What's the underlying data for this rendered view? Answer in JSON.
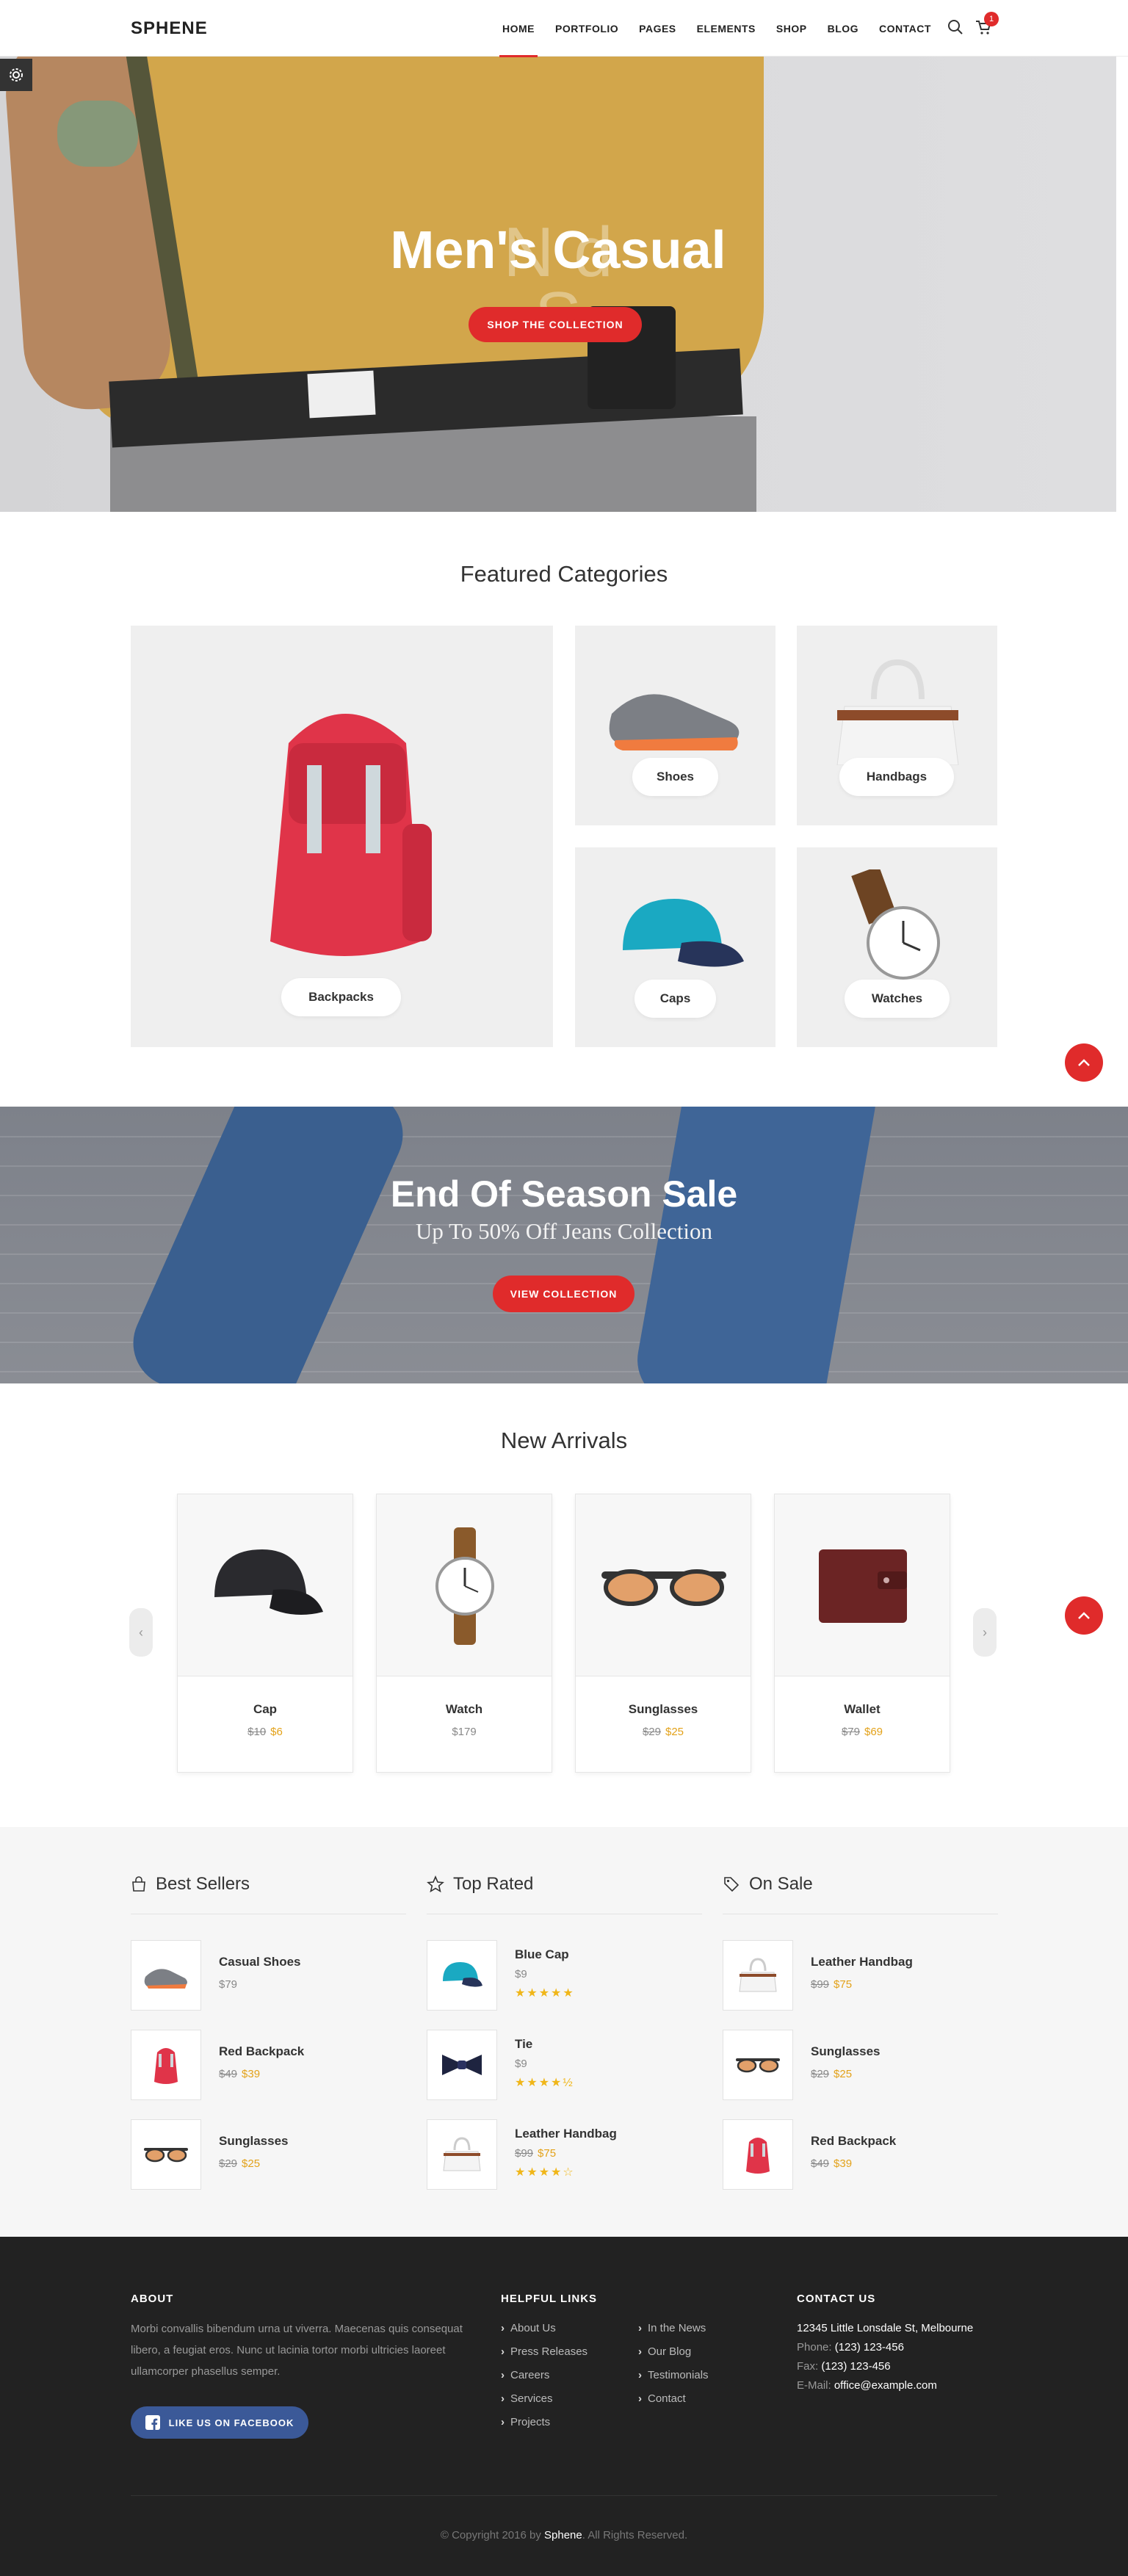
{
  "header": {
    "logo": "SPHENE",
    "nav": [
      "HOME",
      "PORTFOLIO",
      "PAGES",
      "ELEMENTS",
      "SHOP",
      "BLOG",
      "CONTACT"
    ],
    "active_nav": "HOME",
    "cart_count": "1"
  },
  "hero": {
    "ghost_line1": "N          d",
    "ghost_line2": "S",
    "title": "Men's Casual",
    "button": "SHOP THE COLLECTION"
  },
  "featured": {
    "title": "Featured Categories",
    "categories": [
      "Backpacks",
      "Shoes",
      "Handbags",
      "Caps",
      "Watches"
    ]
  },
  "sale": {
    "title": "End Of Season Sale",
    "subtitle": "Up To 50% Off Jeans Collection",
    "button": "VIEW COLLECTION"
  },
  "arrivals": {
    "title": "New Arrivals",
    "products": [
      {
        "name": "Cap",
        "old_price": "$10",
        "price": "$6"
      },
      {
        "name": "Watch",
        "old_price": "",
        "price": "$179"
      },
      {
        "name": "Sunglasses",
        "old_price": "$29",
        "price": "$25"
      },
      {
        "name": "Wallet",
        "old_price": "$79",
        "price": "$69"
      }
    ],
    "prev_arrow": "‹",
    "next_arrow": "›"
  },
  "lists": {
    "best_sellers": {
      "title": "Best Sellers",
      "items": [
        {
          "name": "Casual Shoes",
          "old_price": "",
          "price": "$79"
        },
        {
          "name": "Red Backpack",
          "old_price": "$49",
          "price": "$39"
        },
        {
          "name": "Sunglasses",
          "old_price": "$29",
          "price": "$25"
        }
      ]
    },
    "top_rated": {
      "title": "Top Rated",
      "items": [
        {
          "name": "Blue Cap",
          "old_price": "",
          "price": "$9",
          "stars": "★★★★★"
        },
        {
          "name": "Tie",
          "old_price": "",
          "price": "$9",
          "stars": "★★★★½"
        },
        {
          "name": "Leather Handbag",
          "old_price": "$99",
          "price": "$75",
          "stars": "★★★★☆"
        }
      ]
    },
    "on_sale": {
      "title": "On Sale",
      "items": [
        {
          "name": "Leather Handbag",
          "old_price": "$99",
          "price": "$75"
        },
        {
          "name": "Sunglasses",
          "old_price": "$29",
          "price": "$25"
        },
        {
          "name": "Red Backpack",
          "old_price": "$49",
          "price": "$39"
        }
      ]
    }
  },
  "footer": {
    "about_title": "ABOUT",
    "about_line1": "Morbi convallis bibendum urna ut viverra. Maecenas quis consequat",
    "about_line2": "libero, a feugiat eros. Nunc ut lacinia tortor morbi ultricies laoreet",
    "about_line3": "ullamcorper phasellus semper.",
    "facebook_button": "LIKE US ON FACEBOOK",
    "links_title": "HELPFUL LINKS",
    "links_col1": [
      "About Us",
      "Press Releases",
      "Careers",
      "Services",
      "Projects"
    ],
    "links_col2": [
      "In the News",
      "Our Blog",
      "Testimonials",
      "Contact"
    ],
    "contact_title": "CONTACT US",
    "address": "12345 Little Lonsdale St, Melbourne",
    "phone_label": "Phone:",
    "phone": "(123) 123-456",
    "fax_label": "Fax:",
    "fax": "(123) 123-456",
    "email_label": "E-Mail:",
    "email": "office@example.com",
    "copyright_pre": "© Copyright 2016 by",
    "copyright_brand": "Sphene",
    "copyright_post": ". All Rights Reserved."
  },
  "colors": {
    "accent": "#e02b2b",
    "price": "#e3a21a",
    "stars": "#f0b619",
    "footer_bg": "#222222",
    "facebook": "#3b5998"
  }
}
